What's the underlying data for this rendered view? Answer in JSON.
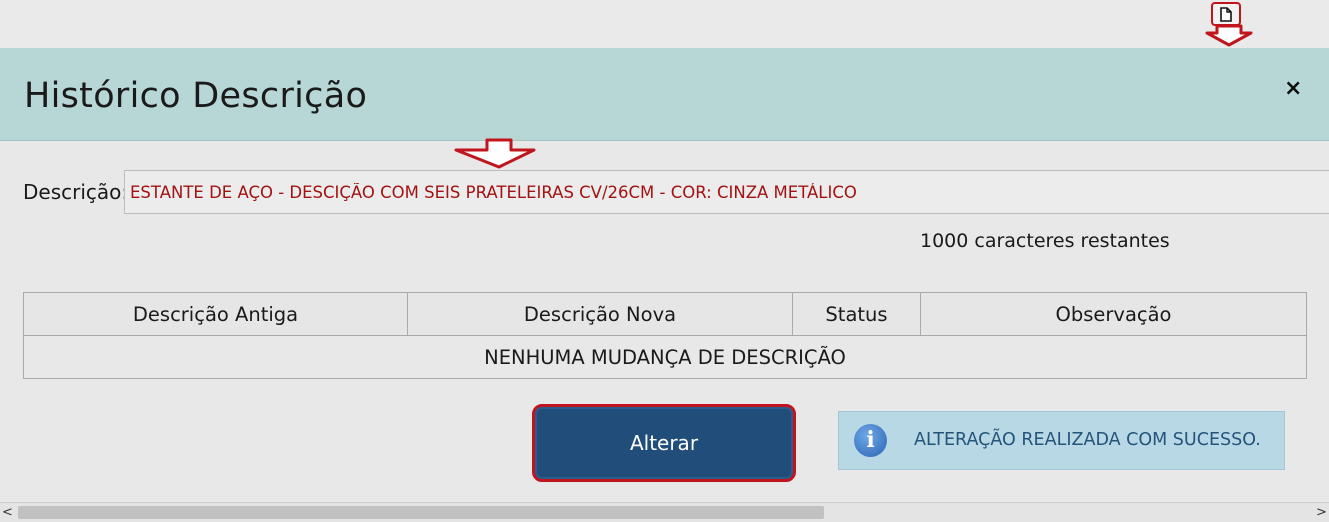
{
  "top_icon": "document-icon",
  "modal": {
    "title": "Histórico Descrição",
    "close_label": "×"
  },
  "description": {
    "label": "Descrição:",
    "value": "ESTANTE DE AÇO - DESCIÇÃO COM SEIS PRATELEIRAS CV/26CM - COR: CINZA METÁLICO",
    "remaining": "1000 caracteres restantes"
  },
  "history_table": {
    "columns": [
      "Descrição Antiga",
      "Descrição Nova",
      "Status",
      "Observação"
    ],
    "empty_message": "NENHUMA MUDANÇA DE DESCRIÇÃO"
  },
  "actions": {
    "submit_label": "Alterar"
  },
  "alert": {
    "icon": "info-icon",
    "message": "ALTERAÇÃO REALIZADA COM SUCESSO."
  },
  "scrollbar": {
    "left_arrow": "<",
    "right_arrow": ">"
  },
  "colors": {
    "header_bg": "#b7d6d6",
    "button_bg": "#204d7a",
    "highlight": "#c0151d",
    "input_text": "#a31212",
    "alert_bg": "#b8d8e6"
  }
}
